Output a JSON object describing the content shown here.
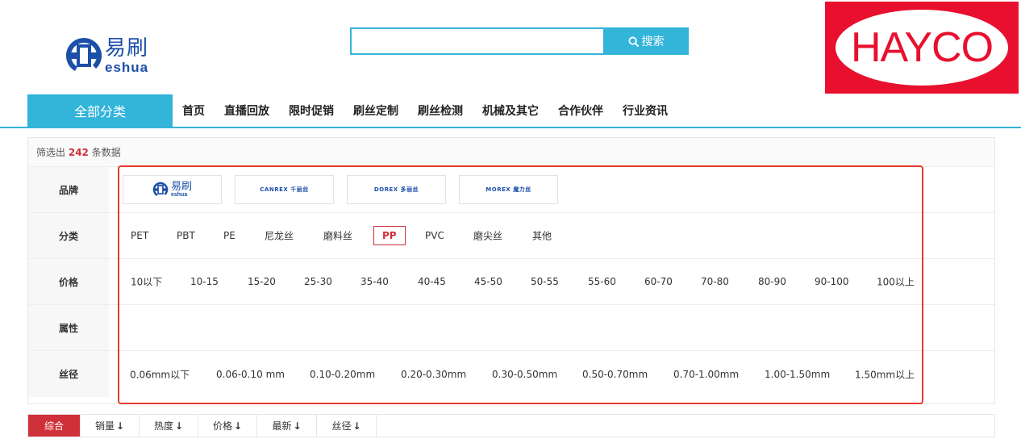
{
  "header": {
    "logo": {
      "cn": "易刷",
      "en": "eshua"
    },
    "search": {
      "value": "",
      "placeholder": "",
      "button_label": "搜索"
    },
    "ad": {
      "text": "HAYCO"
    }
  },
  "nav": {
    "all_categories": "全部分类",
    "items": [
      "首页",
      "直播回放",
      "限时促销",
      "刷丝定制",
      "刷丝检测",
      "机械及其它",
      "合作伙伴",
      "行业资讯"
    ]
  },
  "filter": {
    "summary_prefix": "筛选出",
    "count": "242",
    "summary_suffix": "条数据",
    "brand_label": "品牌",
    "brands": [
      {
        "cn": "易刷",
        "en": "eshua"
      },
      {
        "text": "CANREX 千丽丝"
      },
      {
        "text": "DOREX 多丽丝"
      },
      {
        "text": "MOREX 魔力丝"
      }
    ],
    "category_label": "分类",
    "categories": [
      "PET",
      "PBT",
      "PE",
      "尼龙丝",
      "磨料丝",
      "PP",
      "PVC",
      "磨尖丝",
      "其他"
    ],
    "category_active": "PP",
    "price_label": "价格",
    "prices": [
      "10以下",
      "10-15",
      "15-20",
      "25-30",
      "35-40",
      "40-45",
      "45-50",
      "50-55",
      "55-60",
      "60-70",
      "70-80",
      "80-90",
      "90-100",
      "100以上"
    ],
    "attribute_label": "属性",
    "diameter_label": "丝径",
    "diameters": [
      "0.06mm以下",
      "0.06-0.10 mm",
      "0.10-0.20mm",
      "0.20-0.30mm",
      "0.30-0.50mm",
      "0.50-0.70mm",
      "0.70-1.00mm",
      "1.00-1.50mm",
      "1.50mm以上"
    ]
  },
  "sort": {
    "items": [
      "综合",
      "销量",
      "热度",
      "价格",
      "最新",
      "丝径"
    ],
    "active": "综合"
  },
  "colors": {
    "accent": "#33b4d9",
    "active_red": "#d0303a",
    "highlight_red": "#e53a2f",
    "brand_blue": "#1c4fa8",
    "ad_red": "#e8102e"
  },
  "icons": {
    "search": "search-icon",
    "sort_arrow": "arrow-down-icon"
  }
}
